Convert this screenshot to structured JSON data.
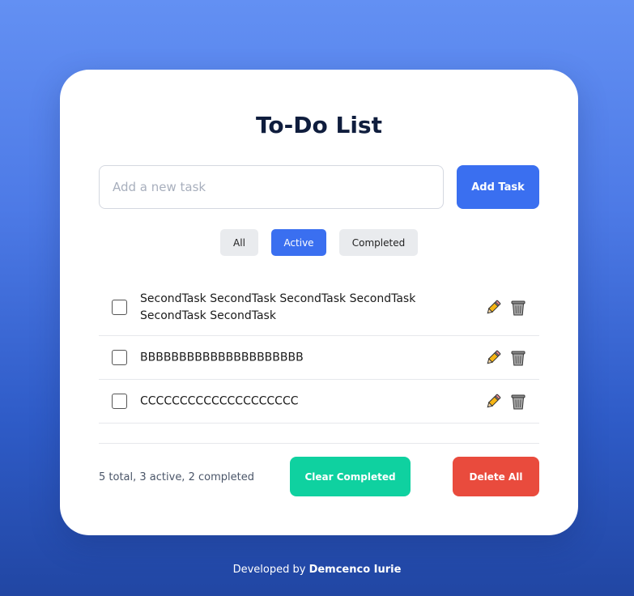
{
  "app": {
    "title": "To-Do List"
  },
  "input": {
    "placeholder": "Add a new task",
    "value": ""
  },
  "add_button": {
    "label": "Add Task"
  },
  "filters": [
    {
      "label": "All",
      "selected": false
    },
    {
      "label": "Active",
      "selected": true
    },
    {
      "label": "Completed",
      "selected": false
    }
  ],
  "tasks": [
    {
      "text": "SecondTask SecondTask SecondTask SecondTask SecondTask SecondTask",
      "checked": false
    },
    {
      "text": "BBBBBBBBBBBBBBBBBBBBB",
      "checked": false
    },
    {
      "text": "CCCCCCCCCCCCCCCCCCCC",
      "checked": false
    }
  ],
  "stats": {
    "text": "5 total, 3 active, 2 completed"
  },
  "actions": {
    "clear_completed": "Clear Completed",
    "delete_all": "Delete All"
  },
  "footer": {
    "prefix": "Developed by",
    "author": "Demcenco Iurie"
  },
  "icons": {
    "edit": "pencil-icon",
    "delete": "trash-icon"
  },
  "colors": {
    "accent": "#3a6ff0",
    "clear": "#0fd1a0",
    "danger": "#e94b3d"
  }
}
